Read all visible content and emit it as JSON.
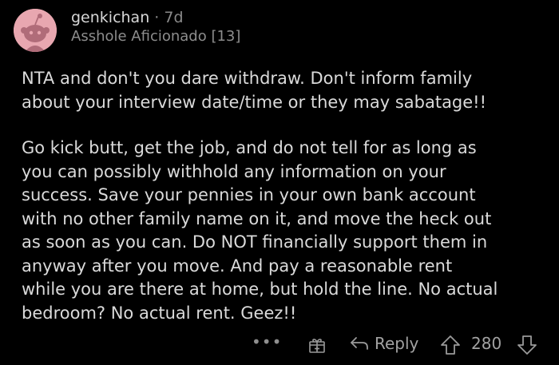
{
  "comment": {
    "author": "genkichan",
    "separator": "·",
    "age": "7d",
    "flair": "Asshole Aficionado [13]",
    "paragraphs": [
      [
        "NTA and don't you dare withdraw. Don't inform family",
        "about your interview date/time or they may sabatage!!"
      ],
      [
        "Go kick butt, get the job, and do not tell for as long as",
        "you can possibly withhold any information on your",
        "success. Save your pennies in your own bank account",
        "with no other family name on it, and move the heck out",
        "as soon as you can. Do NOT financially support them in",
        "anyway after you move. And pay a reasonable rent",
        "while you are there at home, but hold the line. No actual",
        "bedroom? No actual rent. Geez!!"
      ]
    ]
  },
  "actions": {
    "more": "•••",
    "reply_label": "Reply",
    "score": "280"
  },
  "colors": {
    "background": "#000000",
    "avatar": "#e8a7b0",
    "text": "#dadada",
    "muted": "#8d8d8d"
  },
  "icons": {
    "avatar": "snoo-avatar-icon",
    "more": "more-options-icon",
    "award": "award-gift-icon",
    "reply": "reply-arrow-icon",
    "upvote": "upvote-arrow-icon",
    "downvote": "downvote-arrow-icon"
  }
}
